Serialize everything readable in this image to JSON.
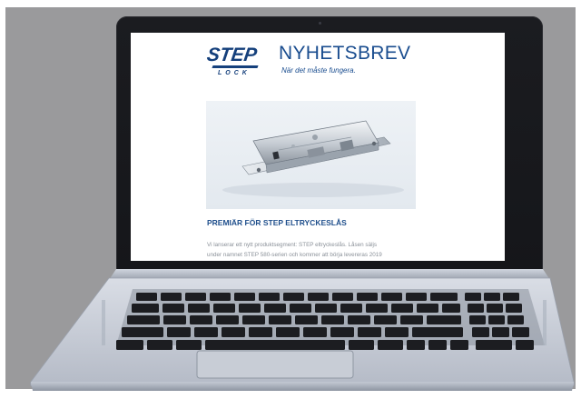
{
  "newsletter": {
    "logo_word": "STEP",
    "logo_sub": "LOCK",
    "title": "NYHETSBREV",
    "tagline": "När det måste fungera.",
    "section_heading": "PREMIÄR FÖR STEP ELTRYCKESLÅS",
    "body_line_1": "Vi lanserar ett nytt produktsegment: STEP eltryckeslås. Låsen säljs",
    "body_line_2": "under namnet STEP 580-serien och kommer att börja levereras 2019"
  },
  "colors": {
    "brand_blue": "#1a4d8f",
    "backdrop_gray": "#9a9a9c",
    "laptop_bezel": "#18191d",
    "laptop_silver": "#c9ced8"
  },
  "icons": {
    "hero": "door-lock-mechanism",
    "device": "laptop"
  }
}
